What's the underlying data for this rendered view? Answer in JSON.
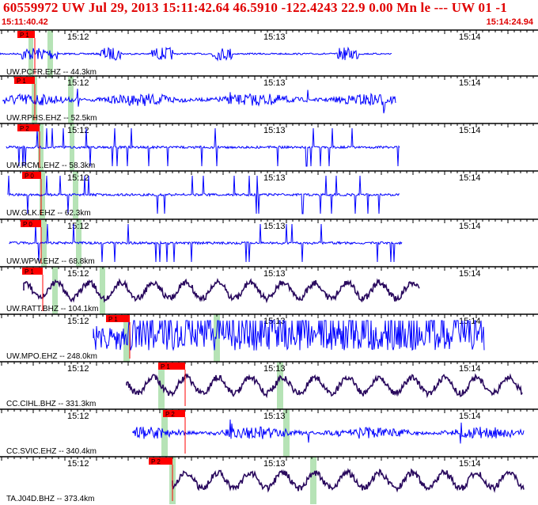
{
  "header": {
    "title": "60559972 UW Jul 29, 2013 15:11:42.64    46.5910 -122.4243 22.9 0.00 Mn le --- UW 01   -1",
    "start_time": "15:11:40.42",
    "end_time": "15:14:24.94"
  },
  "time_labels": [
    "15:12",
    "15:13",
    "15:14"
  ],
  "colors": {
    "header": "#e00000",
    "trace_blue": "#0000ff",
    "trace_purple": "#2a0a5e",
    "pick": "#ff0000",
    "highlight": "#b6e3b6"
  },
  "traces": [
    {
      "label": "UW.PCFR.EHZ -- 44.3km",
      "pick": "P 1",
      "color": "blue"
    },
    {
      "label": "UW.RPHS.EHZ -- 52.5km",
      "pick": "P 1",
      "color": "blue"
    },
    {
      "label": "UW.RCM..EHZ -- 58.3km",
      "pick": "P 2",
      "color": "blue"
    },
    {
      "label": "UW.GLK.EHZ -- 62.3km",
      "pick": "P 0",
      "color": "blue"
    },
    {
      "label": "UW.WPW.EHZ -- 68.8km",
      "pick": "P 0",
      "color": "blue"
    },
    {
      "label": "UW.RATT.BHZ -- 104.1km",
      "pick": "P 1",
      "color": "purple"
    },
    {
      "label": "UW.MPO.EHZ -- 248.0km",
      "pick": "P 1",
      "color": "blue"
    },
    {
      "label": "CC.CIHL.BHZ -- 331.3km",
      "pick": "P 1",
      "color": "purple"
    },
    {
      "label": "CC.SVIC.EHZ -- 340.4km",
      "pick": "P 2",
      "color": "blue"
    },
    {
      "label": "TA.J04D.BHZ -- 373.4km",
      "pick": "P 2",
      "color": "purple"
    }
  ]
}
